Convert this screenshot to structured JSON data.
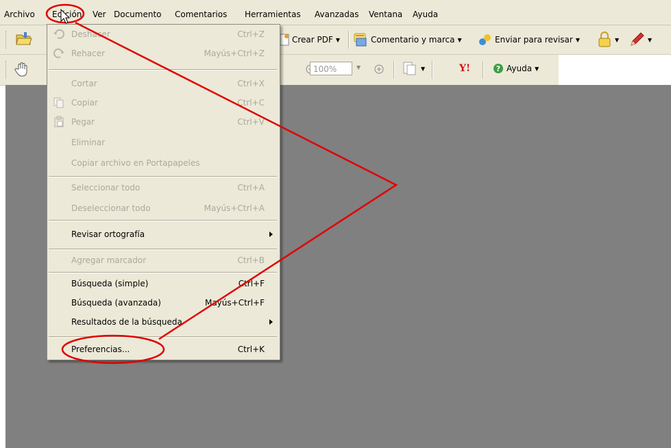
{
  "menubar": {
    "items": [
      "Archivo",
      "Edición",
      "Ver",
      "Documento",
      "Comentarios",
      "Herramientas",
      "Avanzadas",
      "Ventana",
      "Ayuda"
    ]
  },
  "toolbar1": {
    "crear_pdf": "Crear PDF",
    "comentario": "Comentario y marca",
    "enviar": "Enviar para revisar"
  },
  "toolbar2": {
    "zoom_value": "100%",
    "ayuda": "Ayuda"
  },
  "edit_menu": {
    "items": [
      {
        "label": "Deshacer",
        "shortcut": "Ctrl+Z"
      },
      {
        "label": "Rehacer",
        "shortcut": "Mayús+Ctrl+Z"
      },
      {
        "label": "Cortar",
        "shortcut": "Ctrl+X"
      },
      {
        "label": "Copiar",
        "shortcut": "Ctrl+C"
      },
      {
        "label": "Pegar",
        "shortcut": "Ctrl+V"
      },
      {
        "label": "Eliminar",
        "shortcut": ""
      },
      {
        "label": "Copiar archivo en Portapapeles",
        "shortcut": ""
      },
      {
        "label": "Seleccionar todo",
        "shortcut": "Ctrl+A"
      },
      {
        "label": "Deseleccionar todo",
        "shortcut": "Mayús+Ctrl+A"
      },
      {
        "label": "Revisar ortografía",
        "shortcut": ""
      },
      {
        "label": "Agregar marcador",
        "shortcut": "Ctrl+B"
      },
      {
        "label": "Búsqueda (simple)",
        "shortcut": "Ctrl+F"
      },
      {
        "label": "Búsqueda (avanzada)",
        "shortcut": "Mayús+Ctrl+F"
      },
      {
        "label": "Resultados de la búsqueda",
        "shortcut": ""
      },
      {
        "label": "Preferencias...",
        "shortcut": "Ctrl+K"
      }
    ]
  },
  "colors": {
    "annotation": "#e00000",
    "workspace": "#808080",
    "chrome": "#ece9d8",
    "disabled_text": "#aaa99d"
  }
}
